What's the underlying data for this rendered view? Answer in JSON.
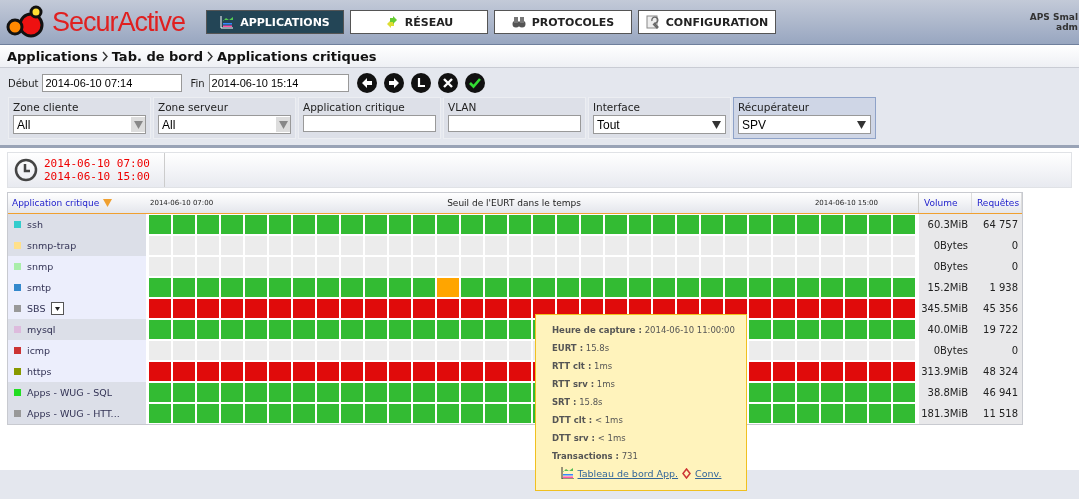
{
  "header": {
    "logo": "SecurActive",
    "nav": [
      {
        "label": "APPLICATIONS",
        "selected": true
      },
      {
        "label": "RÉSEAU",
        "selected": false
      },
      {
        "label": "PROTOCOLES",
        "selected": false
      },
      {
        "label": "CONFIGURATION",
        "selected": false
      }
    ],
    "user": [
      "APS Smal",
      "adm"
    ]
  },
  "breadcrumb": [
    "Applications",
    "Tab. de bord",
    "Applications critiques"
  ],
  "period": {
    "start_label": "Début",
    "start": "2014-06-10 07:14",
    "end_label": "Fin",
    "end": "2014-06-10 15:14"
  },
  "filters": [
    {
      "label": "Zone cliente",
      "kind": "combo",
      "value": "All",
      "selected": false
    },
    {
      "label": "Zone serveur",
      "kind": "combo",
      "value": "All",
      "selected": false
    },
    {
      "label": "Application critique",
      "kind": "text",
      "selected": false
    },
    {
      "label": "VLAN",
      "kind": "text",
      "selected": false
    },
    {
      "label": "Interface",
      "kind": "select",
      "value": "Tout",
      "selected": false
    },
    {
      "label": "Récupérateur",
      "kind": "select",
      "value": "SPV",
      "selected": true
    }
  ],
  "range": [
    "2014-06-10 07:00",
    "2014-06-10 15:00"
  ],
  "table": {
    "columns": [
      "Application critique",
      "2014-06-10 07:00",
      "Seuil de l'EURT dans le temps",
      "2014-06-10 15:00",
      "Volume",
      "Requêtes"
    ],
    "rows": [
      {
        "name": "ssh",
        "color": "#33cccc",
        "highlighted": false,
        "menu": false,
        "volume": "60.3MiB",
        "requests": "64 757",
        "cells": [
          {
            "color": "#33bb33"
          },
          {
            "color": "#33bb33"
          },
          {
            "color": "#33bb33"
          },
          {
            "color": "#33bb33"
          },
          {
            "color": "#33bb33"
          },
          {
            "color": "#33bb33"
          },
          {
            "color": "#33bb33"
          },
          {
            "color": "#33bb33"
          },
          {
            "color": "#33bb33"
          },
          {
            "color": "#33bb33"
          },
          {
            "color": "#33bb33"
          },
          {
            "color": "#33bb33"
          },
          {
            "color": "#33bb33"
          },
          {
            "color": "#33bb33"
          },
          {
            "color": "#33bb33"
          },
          {
            "color": "#33bb33"
          },
          {
            "color": "#33bb33"
          },
          {
            "color": "#33bb33"
          },
          {
            "color": "#33bb33"
          },
          {
            "color": "#33bb33"
          },
          {
            "color": "#33bb33"
          },
          {
            "color": "#33bb33"
          },
          {
            "color": "#33bb33"
          },
          {
            "color": "#33bb33"
          },
          {
            "color": "#33bb33"
          },
          {
            "color": "#33bb33"
          },
          {
            "color": "#33bb33"
          },
          {
            "color": "#33bb33"
          },
          {
            "color": "#33bb33"
          },
          {
            "color": "#33bb33"
          },
          {
            "color": "#33bb33"
          },
          {
            "color": "#33bb33"
          }
        ]
      },
      {
        "name": "snmp-trap",
        "color": "#ffe08a",
        "highlighted": false,
        "menu": false,
        "volume": "0Bytes",
        "requests": "0",
        "cells": [
          {
            "color": "#ececec"
          },
          {
            "color": "#ececec"
          },
          {
            "color": "#ececec"
          },
          {
            "color": "#ececec"
          },
          {
            "color": "#ececec"
          },
          {
            "color": "#ececec"
          },
          {
            "color": "#ececec"
          },
          {
            "color": "#ececec"
          },
          {
            "color": "#ececec"
          },
          {
            "color": "#ececec"
          },
          {
            "color": "#ececec"
          },
          {
            "color": "#ececec"
          },
          {
            "color": "#ececec"
          },
          {
            "color": "#ececec"
          },
          {
            "color": "#ececec"
          },
          {
            "color": "#ececec"
          },
          {
            "color": "#ececec"
          },
          {
            "color": "#ececec"
          },
          {
            "color": "#ececec"
          },
          {
            "color": "#ececec"
          },
          {
            "color": "#ececec"
          },
          {
            "color": "#ececec"
          },
          {
            "color": "#ececec"
          },
          {
            "color": "#ececec"
          },
          {
            "color": "#ececec"
          },
          {
            "color": "#ececec"
          },
          {
            "color": "#ececec"
          },
          {
            "color": "#ececec"
          },
          {
            "color": "#ececec"
          },
          {
            "color": "#ececec"
          },
          {
            "color": "#ececec"
          },
          {
            "color": "#ececec"
          }
        ]
      },
      {
        "name": "snmp",
        "color": "#aaeeaa",
        "highlighted": true,
        "menu": false,
        "volume": "0Bytes",
        "requests": "0",
        "cells": [
          {
            "color": "#ececec"
          },
          {
            "color": "#ececec"
          },
          {
            "color": "#ececec"
          },
          {
            "color": "#ececec"
          },
          {
            "color": "#ececec"
          },
          {
            "color": "#ececec"
          },
          {
            "color": "#ececec"
          },
          {
            "color": "#ececec"
          },
          {
            "color": "#ececec"
          },
          {
            "color": "#ececec"
          },
          {
            "color": "#ececec"
          },
          {
            "color": "#ececec"
          },
          {
            "color": "#ececec"
          },
          {
            "color": "#ececec"
          },
          {
            "color": "#ececec"
          },
          {
            "color": "#ececec"
          },
          {
            "color": "#ececec"
          },
          {
            "color": "#ececec"
          },
          {
            "color": "#ececec"
          },
          {
            "color": "#ececec"
          },
          {
            "color": "#ececec"
          },
          {
            "color": "#ececec"
          },
          {
            "color": "#ececec"
          },
          {
            "color": "#ececec"
          },
          {
            "color": "#ececec"
          },
          {
            "color": "#ececec"
          },
          {
            "color": "#ececec"
          },
          {
            "color": "#ececec"
          },
          {
            "color": "#ececec"
          },
          {
            "color": "#ececec"
          },
          {
            "color": "#ececec"
          },
          {
            "color": "#ececec"
          }
        ]
      },
      {
        "name": "smtp",
        "color": "#3388cc",
        "highlighted": true,
        "menu": false,
        "volume": "15.2MiB",
        "requests": "1 938",
        "cells": [
          {
            "color": "#33bb33"
          },
          {
            "color": "#33bb33"
          },
          {
            "color": "#33bb33"
          },
          {
            "color": "#33bb33"
          },
          {
            "color": "#33bb33"
          },
          {
            "color": "#33bb33"
          },
          {
            "color": "#33bb33"
          },
          {
            "color": "#33bb33"
          },
          {
            "color": "#33bb33"
          },
          {
            "color": "#33bb33"
          },
          {
            "color": "#33bb33"
          },
          {
            "color": "#33bb33"
          },
          {
            "color": "#ffa500"
          },
          {
            "color": "#33bb33"
          },
          {
            "color": "#33bb33"
          },
          {
            "color": "#33bb33"
          },
          {
            "color": "#33bb33"
          },
          {
            "color": "#33bb33"
          },
          {
            "color": "#33bb33"
          },
          {
            "color": "#33bb33"
          },
          {
            "color": "#33bb33"
          },
          {
            "color": "#33bb33"
          },
          {
            "color": "#33bb33"
          },
          {
            "color": "#33bb33"
          },
          {
            "color": "#33bb33"
          },
          {
            "color": "#33bb33"
          },
          {
            "color": "#33bb33"
          },
          {
            "color": "#33bb33"
          },
          {
            "color": "#33bb33"
          },
          {
            "color": "#33bb33"
          },
          {
            "color": "#33bb33"
          },
          {
            "color": "#33bb33"
          }
        ]
      },
      {
        "name": "SBS",
        "color": "#999999",
        "highlighted": true,
        "menu": true,
        "volume": "345.5MiB",
        "requests": "45 356",
        "cells": [
          {
            "color": "#e00b0b"
          },
          {
            "color": "#e00b0b"
          },
          {
            "color": "#e00b0b"
          },
          {
            "color": "#e00b0b"
          },
          {
            "color": "#e00b0b"
          },
          {
            "color": "#e00b0b"
          },
          {
            "color": "#e00b0b"
          },
          {
            "color": "#e00b0b"
          },
          {
            "color": "#e00b0b"
          },
          {
            "color": "#e00b0b"
          },
          {
            "color": "#e00b0b"
          },
          {
            "color": "#e00b0b"
          },
          {
            "color": "#e00b0b"
          },
          {
            "color": "#e00b0b"
          },
          {
            "color": "#e00b0b"
          },
          {
            "color": "#e00b0b"
          },
          {
            "color": "#e00b0b"
          },
          {
            "color": "#e00b0b"
          },
          {
            "color": "#e00b0b"
          },
          {
            "color": "#e00b0b"
          },
          {
            "color": "#e00b0b"
          },
          {
            "color": "#e00b0b"
          },
          {
            "color": "#e00b0b"
          },
          {
            "color": "#e00b0b"
          },
          {
            "color": "#e00b0b"
          },
          {
            "color": "#e00b0b"
          },
          {
            "color": "#e00b0b"
          },
          {
            "color": "#e00b0b"
          },
          {
            "color": "#e00b0b"
          },
          {
            "color": "#e00b0b"
          },
          {
            "color": "#e00b0b"
          },
          {
            "color": "#e00b0b"
          }
        ]
      },
      {
        "name": "mysql",
        "color": "#ddbbdd",
        "highlighted": false,
        "menu": false,
        "volume": "40.0MiB",
        "requests": "19 722",
        "cells": [
          {
            "color": "#33bb33"
          },
          {
            "color": "#33bb33"
          },
          {
            "color": "#33bb33"
          },
          {
            "color": "#33bb33"
          },
          {
            "color": "#33bb33"
          },
          {
            "color": "#33bb33"
          },
          {
            "color": "#33bb33"
          },
          {
            "color": "#33bb33"
          },
          {
            "color": "#33bb33"
          },
          {
            "color": "#33bb33"
          },
          {
            "color": "#33bb33"
          },
          {
            "color": "#33bb33"
          },
          {
            "color": "#33bb33"
          },
          {
            "color": "#33bb33"
          },
          {
            "color": "#33bb33"
          },
          {
            "color": "#33bb33"
          },
          {
            "color": "#33bb33"
          },
          {},
          {},
          {},
          {},
          {},
          {},
          {},
          {},
          {
            "color": "#33bb33"
          },
          {
            "color": "#33bb33"
          },
          {
            "color": "#33bb33"
          },
          {
            "color": "#33bb33"
          },
          {
            "color": "#33bb33"
          },
          {
            "color": "#33bb33"
          },
          {
            "color": "#33bb33"
          }
        ]
      },
      {
        "name": "icmp",
        "color": "#cc3333",
        "highlighted": true,
        "menu": false,
        "volume": "0Bytes",
        "requests": "0",
        "cells": [
          {
            "color": "#ececec"
          },
          {
            "color": "#ececec"
          },
          {
            "color": "#ececec"
          },
          {
            "color": "#ececec"
          },
          {
            "color": "#ececec"
          },
          {
            "color": "#ececec"
          },
          {
            "color": "#ececec"
          },
          {
            "color": "#ececec"
          },
          {
            "color": "#ececec"
          },
          {
            "color": "#ececec"
          },
          {
            "color": "#ececec"
          },
          {
            "color": "#ececec"
          },
          {
            "color": "#ececec"
          },
          {
            "color": "#ececec"
          },
          {
            "color": "#ececec"
          },
          {
            "color": "#ececec"
          },
          {
            "color": "#ececec"
          },
          {},
          {},
          {},
          {},
          {},
          {},
          {},
          {},
          {
            "color": "#ececec"
          },
          {
            "color": "#ececec"
          },
          {
            "color": "#ececec"
          },
          {
            "color": "#ececec"
          },
          {
            "color": "#ececec"
          },
          {
            "color": "#ececec"
          },
          {
            "color": "#ececec"
          }
        ]
      },
      {
        "name": "https",
        "color": "#889900",
        "highlighted": true,
        "menu": false,
        "volume": "313.9MiB",
        "requests": "48 324",
        "cells": [
          {
            "color": "#e00b0b"
          },
          {
            "color": "#e00b0b"
          },
          {
            "color": "#e00b0b"
          },
          {
            "color": "#e00b0b"
          },
          {
            "color": "#e00b0b"
          },
          {
            "color": "#e00b0b"
          },
          {
            "color": "#e00b0b"
          },
          {
            "color": "#e00b0b"
          },
          {
            "color": "#e00b0b"
          },
          {
            "color": "#e00b0b"
          },
          {
            "color": "#e00b0b"
          },
          {
            "color": "#e00b0b"
          },
          {
            "color": "#e00b0b"
          },
          {
            "color": "#e00b0b"
          },
          {
            "color": "#e00b0b"
          },
          {
            "color": "#e00b0b"
          },
          {
            "color": "#e00b0b"
          },
          {},
          {},
          {},
          {},
          {},
          {},
          {},
          {},
          {
            "color": "#e00b0b"
          },
          {
            "color": "#e00b0b"
          },
          {
            "color": "#e00b0b"
          },
          {
            "color": "#e00b0b"
          },
          {
            "color": "#e00b0b"
          },
          {
            "color": "#e00b0b"
          },
          {
            "color": "#e00b0b"
          }
        ]
      },
      {
        "name": "Apps - WUG - SQL",
        "color": "#22dd22",
        "highlighted": false,
        "menu": false,
        "volume": "38.8MiB",
        "requests": "46 941",
        "cells": [
          {
            "color": "#33bb33"
          },
          {
            "color": "#33bb33"
          },
          {
            "color": "#33bb33"
          },
          {
            "color": "#33bb33"
          },
          {
            "color": "#33bb33"
          },
          {
            "color": "#33bb33"
          },
          {
            "color": "#33bb33"
          },
          {
            "color": "#33bb33"
          },
          {
            "color": "#33bb33"
          },
          {
            "color": "#33bb33"
          },
          {
            "color": "#33bb33"
          },
          {
            "color": "#33bb33"
          },
          {
            "color": "#33bb33"
          },
          {
            "color": "#33bb33"
          },
          {
            "color": "#33bb33"
          },
          {
            "color": "#33bb33"
          },
          {
            "color": "#33bb33"
          },
          {},
          {},
          {},
          {},
          {},
          {},
          {},
          {},
          {
            "color": "#33bb33"
          },
          {
            "color": "#33bb33"
          },
          {
            "color": "#33bb33"
          },
          {
            "color": "#33bb33"
          },
          {
            "color": "#33bb33"
          },
          {
            "color": "#33bb33"
          },
          {
            "color": "#33bb33"
          }
        ]
      },
      {
        "name": "Apps - WUG - HTT...",
        "color": "#999999",
        "highlighted": false,
        "menu": false,
        "volume": "181.3MiB",
        "requests": "11 518",
        "cells": [
          {
            "color": "#33bb33"
          },
          {
            "color": "#33bb33"
          },
          {
            "color": "#33bb33"
          },
          {
            "color": "#33bb33"
          },
          {
            "color": "#33bb33"
          },
          {
            "color": "#33bb33"
          },
          {
            "color": "#33bb33"
          },
          {
            "color": "#33bb33"
          },
          {
            "color": "#33bb33"
          },
          {
            "color": "#33bb33"
          },
          {
            "color": "#33bb33"
          },
          {
            "color": "#33bb33"
          },
          {
            "color": "#33bb33"
          },
          {
            "color": "#33bb33"
          },
          {
            "color": "#33bb33"
          },
          {
            "color": "#33bb33"
          },
          {
            "color": "#33bb33"
          },
          {},
          {},
          {},
          {},
          {},
          {},
          {},
          {},
          {
            "color": "#33bb33"
          },
          {
            "color": "#33bb33"
          },
          {
            "color": "#33bb33"
          },
          {
            "color": "#33bb33"
          },
          {
            "color": "#33bb33"
          },
          {
            "color": "#33bb33"
          },
          {
            "color": "#33bb33"
          }
        ]
      }
    ]
  },
  "tooltip": {
    "lines": [
      "**Heure de capture :** 2014-06-10 11:00:00",
      "**EURT :** 15.8s",
      "**RTT clt :** 1ms",
      "**RTT srv :** 1ms",
      "**SRT :** 15.8s",
      "**DTT clt :** < 1ms",
      "**DTT srv :** < 1ms",
      "**Transactions :** 731"
    ],
    "links": [
      "Tableau de bord App.",
      "Conv."
    ]
  }
}
